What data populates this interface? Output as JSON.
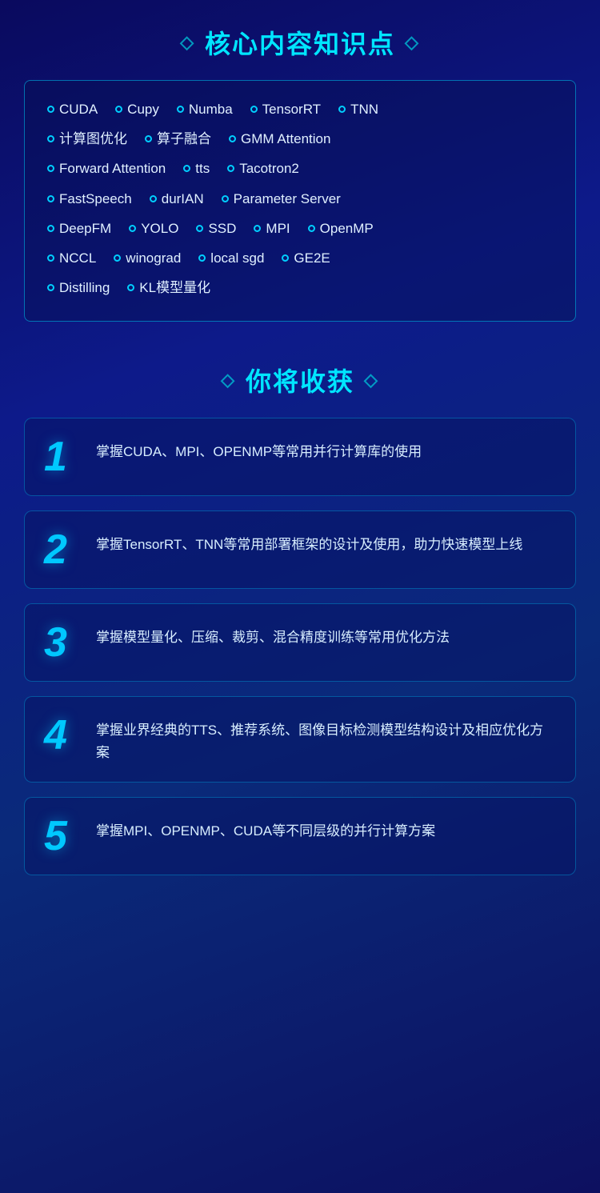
{
  "section1": {
    "title": "核心内容知识点",
    "deco_left": "◇",
    "deco_right": "◇"
  },
  "keywords": [
    [
      "CUDA",
      "Cupy",
      "Numba",
      "TensorRT",
      "TNN"
    ],
    [
      "计算图优化",
      "算子融合",
      "GMM Attention"
    ],
    [
      "Forward Attention",
      "tts",
      "Tacotron2"
    ],
    [
      "FastSpeech",
      "durIAN",
      "Parameter Server"
    ],
    [
      "DeepFM",
      "YOLO",
      "SSD",
      "MPI",
      "OpenMP"
    ],
    [
      "NCCL",
      "winograd",
      "local sgd",
      "GE2E"
    ],
    [
      "Distilling",
      "KL模型量化"
    ]
  ],
  "section2": {
    "title": "你将收获",
    "deco_left": "◇",
    "deco_right": "◇"
  },
  "benefits": [
    {
      "number": "1",
      "text": "掌握CUDA、MPI、OPENMP等常用并行计算库的使用"
    },
    {
      "number": "2",
      "text": "掌握TensorRT、TNN等常用部署框架的设计及使用，助力快速模型上线"
    },
    {
      "number": "3",
      "text": "掌握模型量化、压缩、裁剪、混合精度训练等常用优化方法"
    },
    {
      "number": "4",
      "text": "掌握业界经典的TTS、推荐系统、图像目标检测模型结构设计及相应优化方案"
    },
    {
      "number": "5",
      "text": "掌握MPI、OPENMP、CUDA等不同层级的并行计算方案"
    }
  ]
}
